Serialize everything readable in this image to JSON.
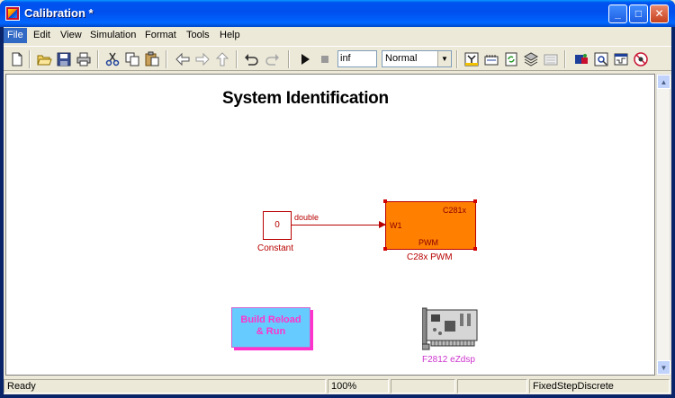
{
  "window": {
    "title": "Calibration *",
    "controls": {
      "minimize": "_",
      "maximize": "□",
      "close": "✕"
    }
  },
  "menu": {
    "items": [
      "File",
      "Edit",
      "View",
      "Simulation",
      "Format",
      "Tools",
      "Help"
    ],
    "active": "File"
  },
  "toolbar": {
    "icons": [
      "new-icon",
      "open-icon",
      "save-icon",
      "print-icon",
      "cut-icon",
      "copy-icon",
      "paste-icon",
      "back-icon",
      "forward-icon",
      "up-icon",
      "undo-icon",
      "redo-icon",
      "start-simulation-icon",
      "stop-simulation-icon",
      "build-icon",
      "update-diagram-icon",
      "refresh-icon",
      "model-browser-icon",
      "library-browser-icon",
      "model-explorer-icon",
      "debugger-icon",
      "signal-builder-icon",
      "no-entry-icon"
    ],
    "stop_time": "inf",
    "sim_mode": "Normal"
  },
  "diagram": {
    "title": "System Identification",
    "constant_block": {
      "value": "0",
      "label": "Constant"
    },
    "signal": {
      "label": "double"
    },
    "pwm_block": {
      "header": "C281x",
      "input_port": "W1",
      "body": "PWM",
      "label": "C28x PWM"
    },
    "build_block": {
      "line1": "Build Reload",
      "line2": "& Run"
    },
    "board_block": {
      "label": "F2812 eZdsp"
    }
  },
  "statusbar": {
    "status": "Ready",
    "zoom": "100%",
    "solver": "FixedStepDiscrete"
  },
  "colors": {
    "title_bar": "#0053ee",
    "block_outline": "#b80000",
    "pwm_fill": "#ff7f00",
    "build_fill": "#66ccff",
    "build_text": "#ff33cc",
    "board_label": "#cc33cc"
  }
}
